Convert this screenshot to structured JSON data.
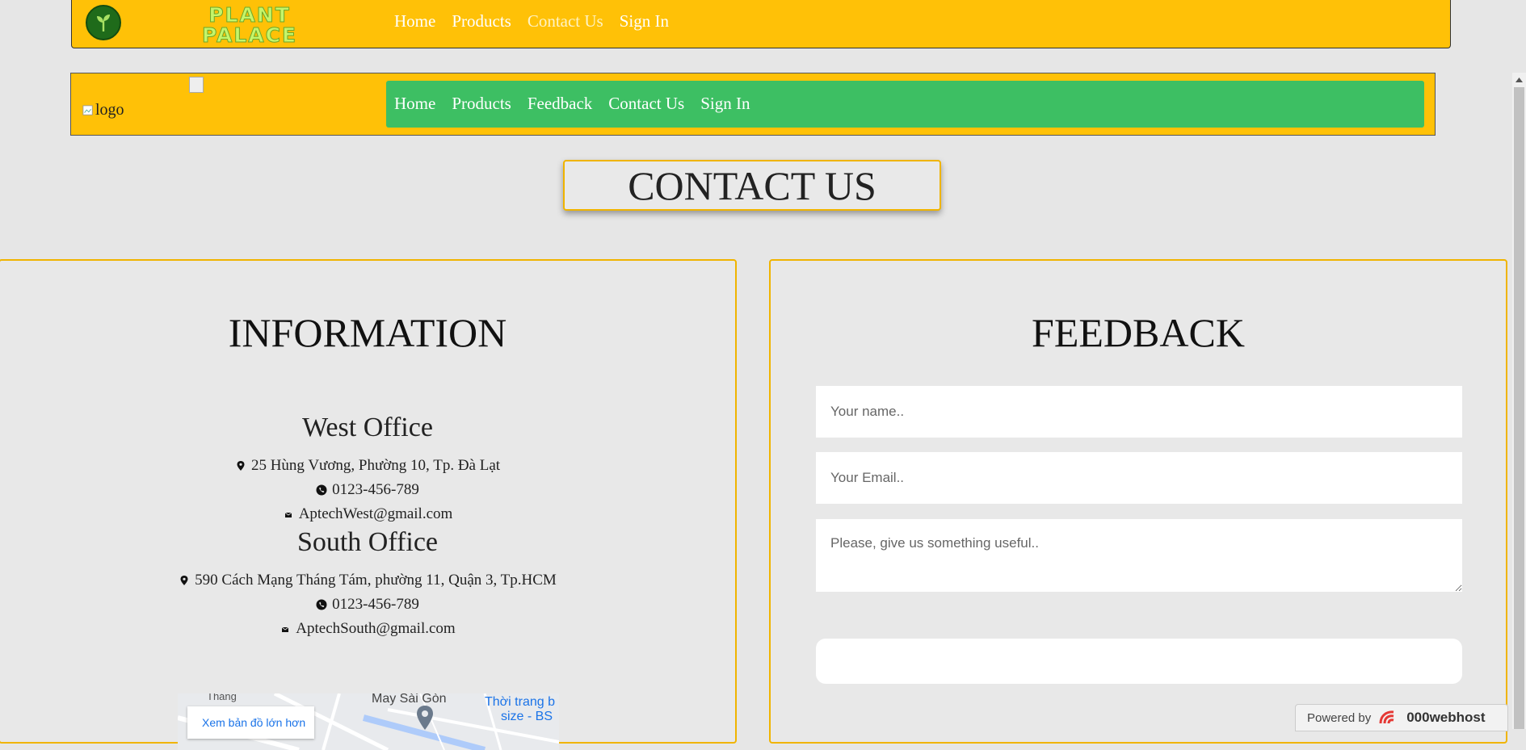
{
  "header_top": {
    "brand": [
      "PLANT",
      "PALACE"
    ],
    "nav": [
      "Home",
      "Products",
      "Contact Us",
      "Sign In"
    ]
  },
  "header_second": {
    "logo_alt": "logo",
    "nav": [
      "Home",
      "Products",
      "Feedback",
      "Contact Us",
      "Sign In"
    ]
  },
  "page_title": "CONTACT US",
  "information": {
    "title": "INFORMATION",
    "offices": [
      {
        "name": "West Office",
        "address": "25 Hùng Vương, Phường 10, Tp. Đà Lạt",
        "phone": "0123-456-789",
        "email": "AptechWest@gmail.com"
      },
      {
        "name": "South Office",
        "address": "590 Cách Mạng Tháng Tám, phường 11, Quận 3, Tp.HCM",
        "phone": "0123-456-789",
        "email": "AptechSouth@gmail.com"
      }
    ],
    "map": {
      "larger_map_link": "Xem bản đồ lớn hơn",
      "labels": [
        "May Sài Gòn",
        "Thời trang b",
        "size - BS",
        "Tháng"
      ]
    }
  },
  "feedback": {
    "title": "FEEDBACK",
    "name_placeholder": "Your name..",
    "email_placeholder": "Your Email..",
    "message_placeholder": "Please, give us something useful.."
  },
  "badge": {
    "powered_by": "Powered by",
    "host": "000webhost"
  },
  "colors": {
    "header": "#ffc107",
    "nav_green": "#3dbf63",
    "panel_border": "#f0b400",
    "background": "#e6e6e6"
  }
}
